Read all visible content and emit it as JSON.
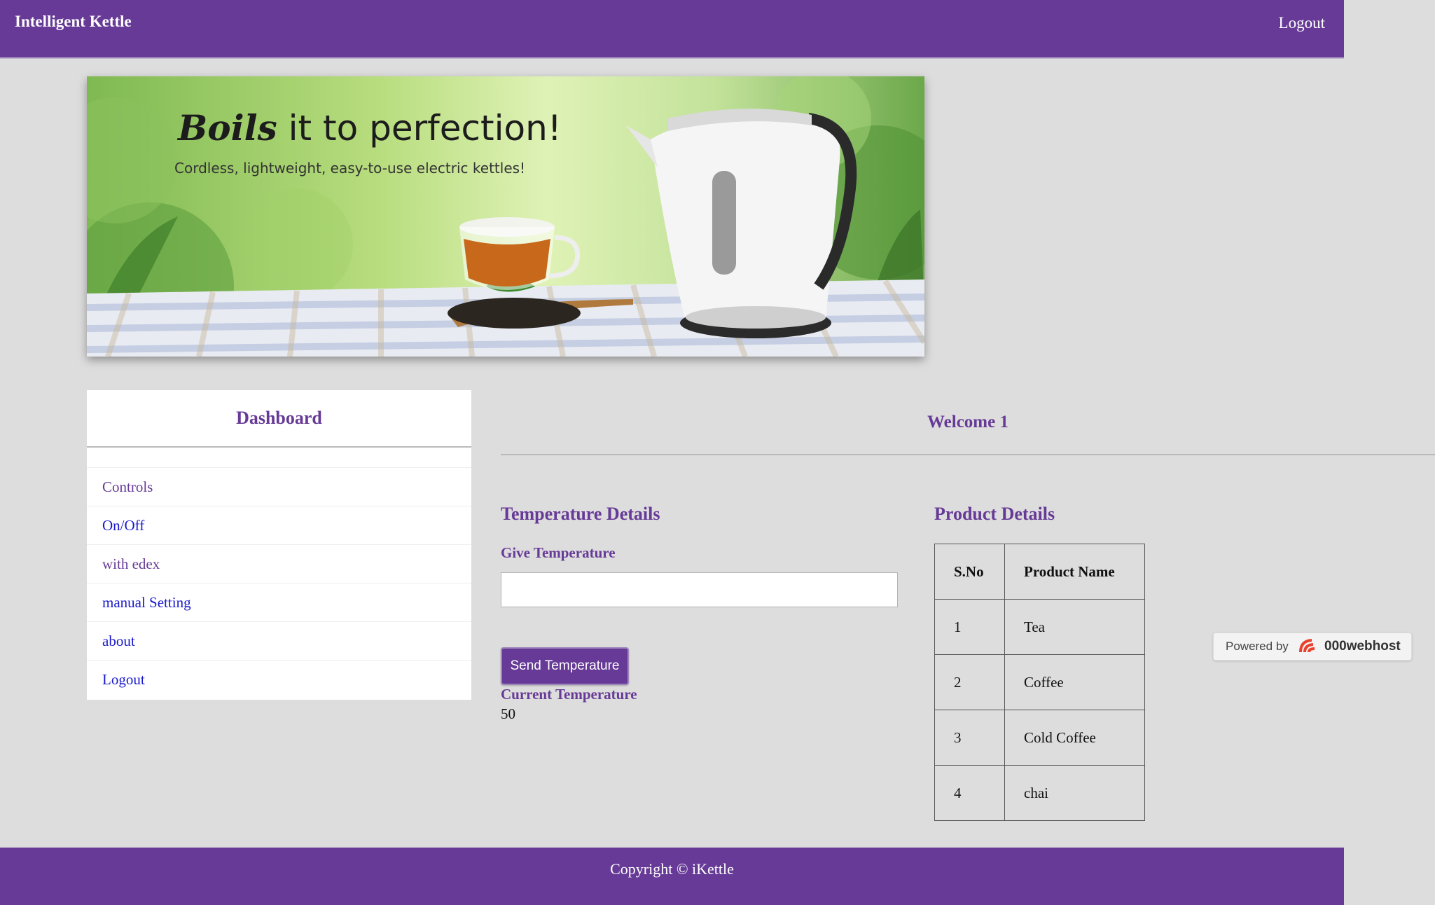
{
  "header": {
    "brand": "Intelligent Kettle",
    "logout": "Logout"
  },
  "banner": {
    "headline_script": "Boils",
    "headline_rest": " it to perfection!",
    "subtitle": "Cordless, lightweight, easy-to-use electric kettles!"
  },
  "sidebar": {
    "title": "Dashboard",
    "items": [
      {
        "label": "Controls",
        "color": "#663a96"
      },
      {
        "label": "On/Off",
        "color": "#1a1acc"
      },
      {
        "label": "with edex",
        "color": "#663a96"
      },
      {
        "label": "manual Setting",
        "color": "#1a1acc"
      },
      {
        "label": "about",
        "color": "#1a1acc"
      },
      {
        "label": "Logout",
        "color": "#1a1acc"
      }
    ]
  },
  "main": {
    "welcome": "Welcome 1",
    "temperature": {
      "title": "Temperature Details",
      "label": "Give Temperature",
      "input_value": "",
      "button": "Send Temperature",
      "current_label": "Current Temperature",
      "current_value": "50"
    },
    "product": {
      "title": "Product Details",
      "headers": [
        "S.No",
        "Product Name"
      ],
      "rows": [
        [
          "1",
          "Tea"
        ],
        [
          "2",
          "Coffee"
        ],
        [
          "3",
          "Cold Coffee"
        ],
        [
          "4",
          "chai"
        ]
      ]
    }
  },
  "badge": {
    "powered": "Powered by",
    "host": "000webhost"
  },
  "footer": {
    "copyright": "Copyright © iKettle"
  },
  "colors": {
    "accent": "#663a96",
    "background": "#dddddd",
    "link": "#1a1acc"
  }
}
